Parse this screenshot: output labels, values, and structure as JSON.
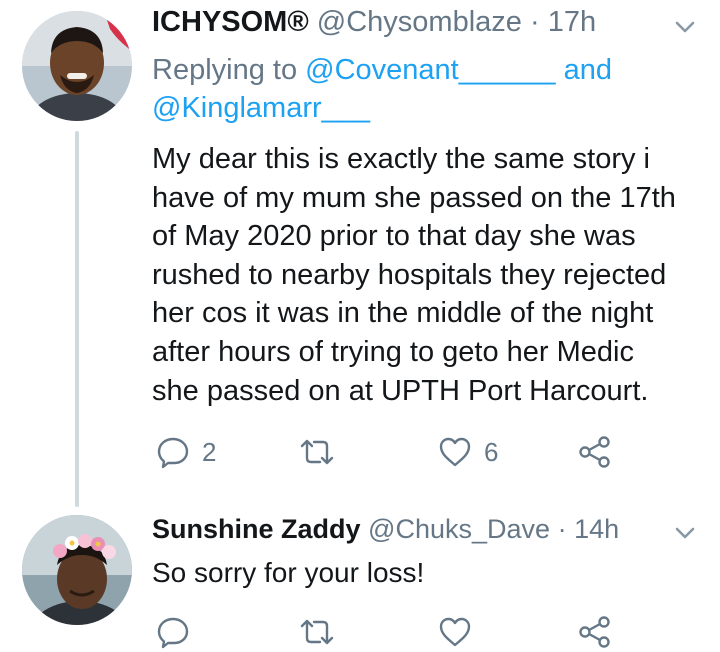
{
  "tweets": [
    {
      "display_name": "ICHYSOM®",
      "handle": "@Chysomblaze",
      "separator": "·",
      "time": "17h",
      "replying_prefix": "Replying to",
      "replying_to_1": "@Covenant______",
      "replying_and": "and",
      "replying_to_2": "@Kinglamarr___",
      "body_lines": [
        "My dear this is exactly the same story i",
        "have of my mum she passed on the 17th",
        "of May 2020 prior to that day she was",
        "rushed to nearby hospitals they rejected",
        "her cos it was in the middle of the night",
        "after hours of trying to geto her Medic",
        "she passed on at UPTH Port Harcourt."
      ],
      "reply_count": "2",
      "retweet_count": "",
      "like_count": "6"
    },
    {
      "display_name": "Sunshine Zaddy",
      "handle": "@Chuks_Dave",
      "separator": "·",
      "time": "14h",
      "body": "So sorry for your loss!"
    }
  ],
  "colors": {
    "text": "#14171a",
    "secondary": "#657786",
    "accent": "#1da1f2",
    "thread_line": "#cfd9de"
  },
  "icons": {
    "reply": "reply-icon",
    "retweet": "retweet-icon",
    "like": "heart-icon",
    "share": "share-icon",
    "more": "chevron-down-icon"
  }
}
